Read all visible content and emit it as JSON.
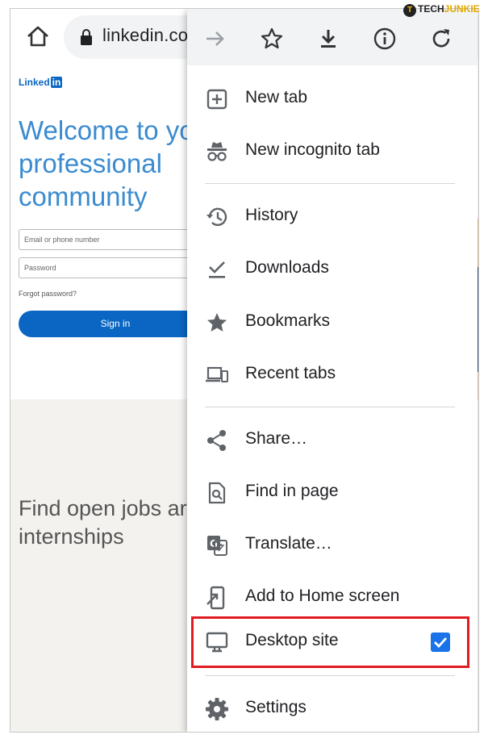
{
  "browser": {
    "url": "linkedin.co"
  },
  "page": {
    "logo": "Linked",
    "logo_in": "in",
    "welcome": "Welcome to yo\nprofessional\ncommunity",
    "email_placeholder": "Email or phone number",
    "password_placeholder": "Password",
    "forgot": "Forgot password?",
    "signin": "Sign in",
    "jobs": "Find open jobs ar\ninternships"
  },
  "menu": {
    "toolbar_icons": [
      "forward-icon",
      "star-icon",
      "download-icon",
      "info-icon",
      "reload-icon"
    ],
    "items": [
      {
        "label": "New tab",
        "icon": "plus-box-icon"
      },
      {
        "label": "New incognito tab",
        "icon": "incognito-icon"
      },
      {
        "label": "History",
        "icon": "history-icon"
      },
      {
        "label": "Downloads",
        "icon": "downloads-check-icon"
      },
      {
        "label": "Bookmarks",
        "icon": "star-filled-icon"
      },
      {
        "label": "Recent tabs",
        "icon": "devices-icon"
      },
      {
        "label": "Share…",
        "icon": "share-icon"
      },
      {
        "label": "Find in page",
        "icon": "find-in-page-icon"
      },
      {
        "label": "Translate…",
        "icon": "translate-icon"
      },
      {
        "label": "Add to Home screen",
        "icon": "add-to-home-icon"
      },
      {
        "label": "Desktop site",
        "icon": "desktop-icon",
        "checked": true
      },
      {
        "label": "Settings",
        "icon": "gear-icon"
      }
    ]
  },
  "colors": {
    "accent": "#1a73e8",
    "highlight": "#e11b22",
    "linkedin_blue": "#0a66c2"
  },
  "watermark": {
    "badge": "T",
    "tech": "TECH",
    "junkie": "JUNKIE"
  }
}
